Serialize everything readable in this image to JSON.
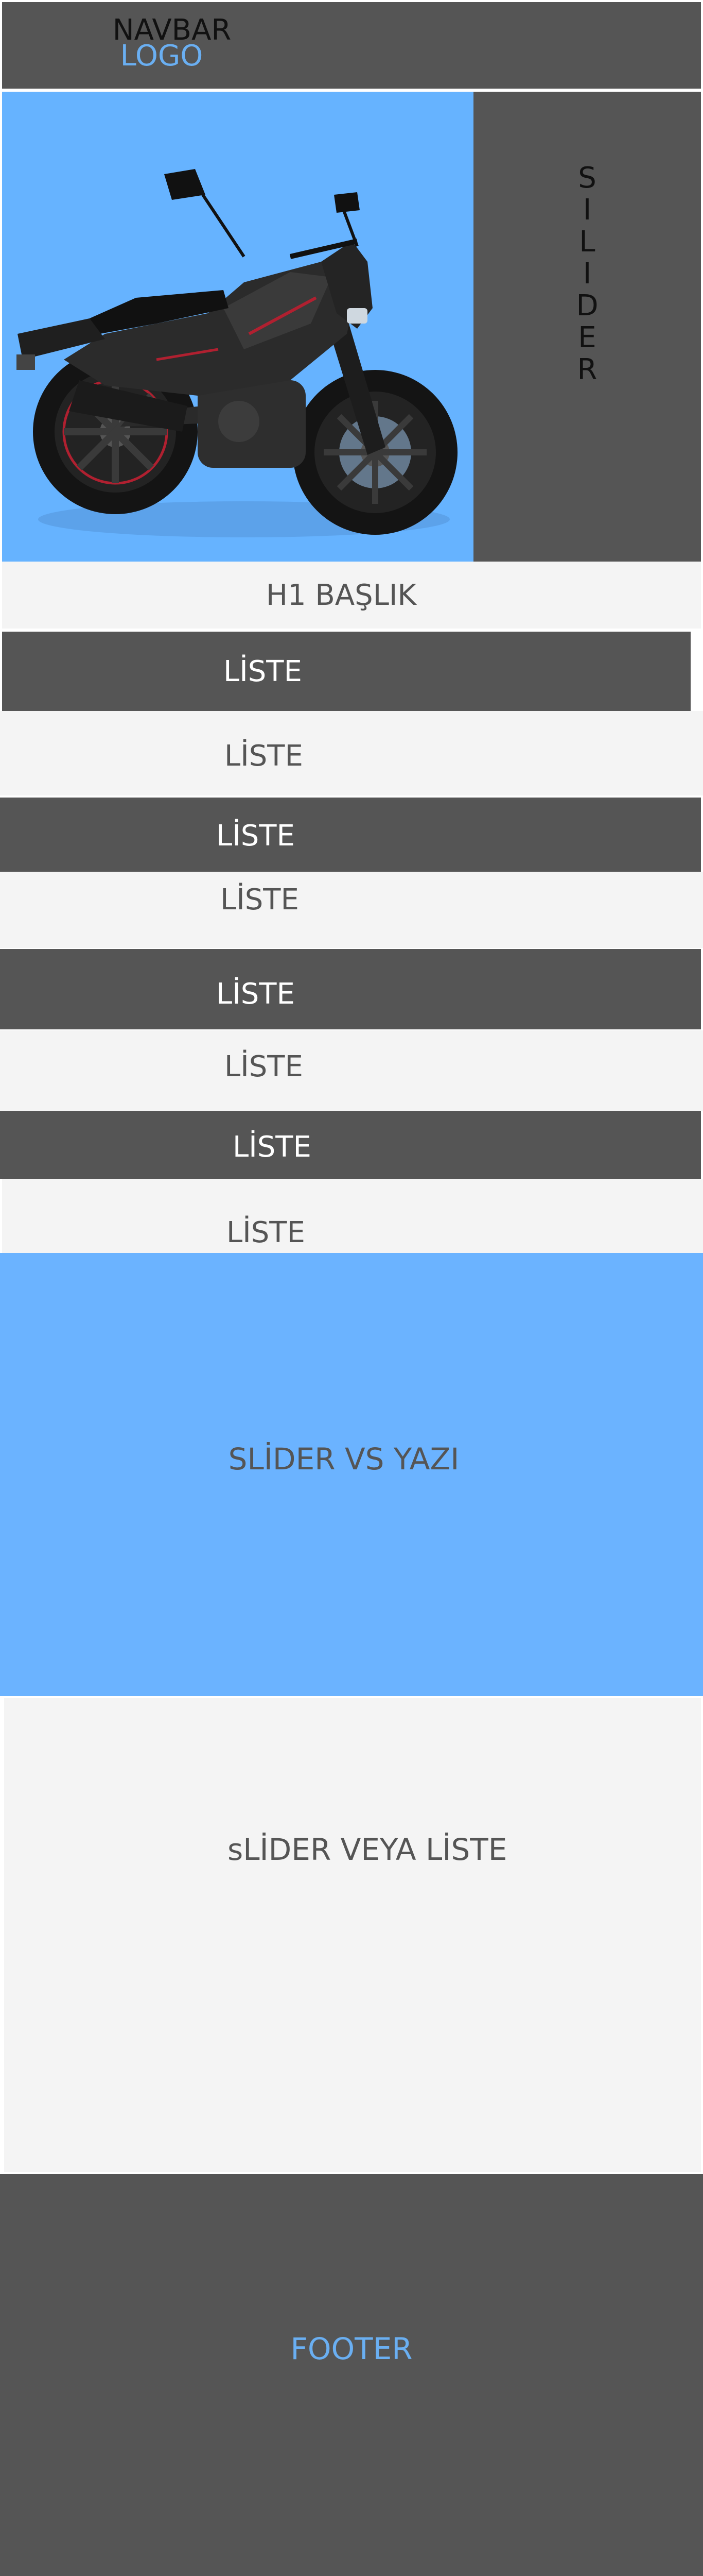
{
  "navbar": {
    "title": "NAVBAR",
    "logo": "LOGO"
  },
  "hero": {
    "slider_letters": [
      "S",
      "I",
      "L",
      "I",
      "D",
      "E",
      "R"
    ]
  },
  "heading": {
    "h1": "H1 BAŞLIK"
  },
  "list_items": [
    {
      "label": "LİSTE",
      "style": "dark"
    },
    {
      "label": "LİSTE",
      "style": "light"
    },
    {
      "label": "LİSTE",
      "style": "dark"
    },
    {
      "label": "LİSTE",
      "style": "light"
    },
    {
      "label": "LİSTE",
      "style": "dark"
    },
    {
      "label": "LİSTE",
      "style": "light"
    },
    {
      "label": "LİSTE",
      "style": "dark"
    },
    {
      "label": "LİSTE",
      "style": "light"
    }
  ],
  "sections": {
    "slider_text": "SLİDER VS YAZI",
    "slider_list": "sLİDER VEYA LİSTE",
    "footer": "FOOTER"
  },
  "colors": {
    "dark_gray": "#555555",
    "light_gray": "#f4f4f4",
    "blue": "#66b3ff",
    "logo_blue": "#6aaff2"
  }
}
